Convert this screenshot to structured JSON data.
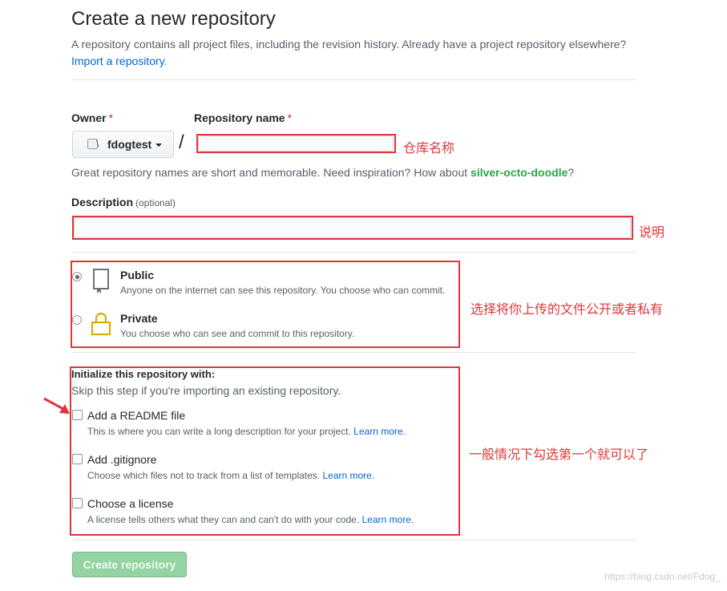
{
  "header": {
    "title": "Create a new repository",
    "subtitle": "A repository contains all project files, including the revision history. Already have a project repository elsewhere?",
    "import_link": "Import a repository."
  },
  "owner": {
    "label": "Owner",
    "required_mark": "*",
    "selected": "fdogtest",
    "avatar_alt": "\\"
  },
  "repo_name": {
    "label": "Repository name",
    "required_mark": "*",
    "value": "",
    "separator": "/",
    "annotation": "仓库名称"
  },
  "name_hint": {
    "text": "Great repository names are short and memorable. Need inspiration? How about ",
    "suggestion": "silver-octo-doodle",
    "end": "?"
  },
  "description": {
    "label": "Description",
    "optional_text": "(optional)",
    "value": "",
    "annotation": "说明"
  },
  "visibility": {
    "annotation": "选择将你上传的文件公开或者私有",
    "options": [
      {
        "title": "Public",
        "desc": "Anyone on the internet can see this repository. You choose who can commit.",
        "icon": "repo-book-icon",
        "checked": true
      },
      {
        "title": "Private",
        "desc": "You choose who can see and commit to this repository.",
        "icon": "lock-icon",
        "checked": false
      }
    ]
  },
  "initialize": {
    "title": "Initialize this repository with:",
    "subtitle": "Skip this step if you're importing an existing repository.",
    "annotation": "一般情况下勾选第一个就可以了",
    "learn_more": "Learn more.",
    "options": [
      {
        "title": "Add a README file",
        "desc": "This is where you can write a long description for your project.",
        "checked": false
      },
      {
        "title": "Add .gitignore",
        "desc": "Choose which files not to track from a list of templates.",
        "checked": false
      },
      {
        "title": "Choose a license",
        "desc": "A license tells others what they can and can't do with your code.",
        "checked": false
      }
    ]
  },
  "submit": {
    "label": "Create repository",
    "enabled": false
  },
  "watermark": "https://blog.csdn.net/Fdog_",
  "colors": {
    "annotation_red": "#e0363a",
    "link_blue": "#0366d6",
    "suggestion_green": "#28a745",
    "button_green_disabled": "#94d3a2"
  }
}
